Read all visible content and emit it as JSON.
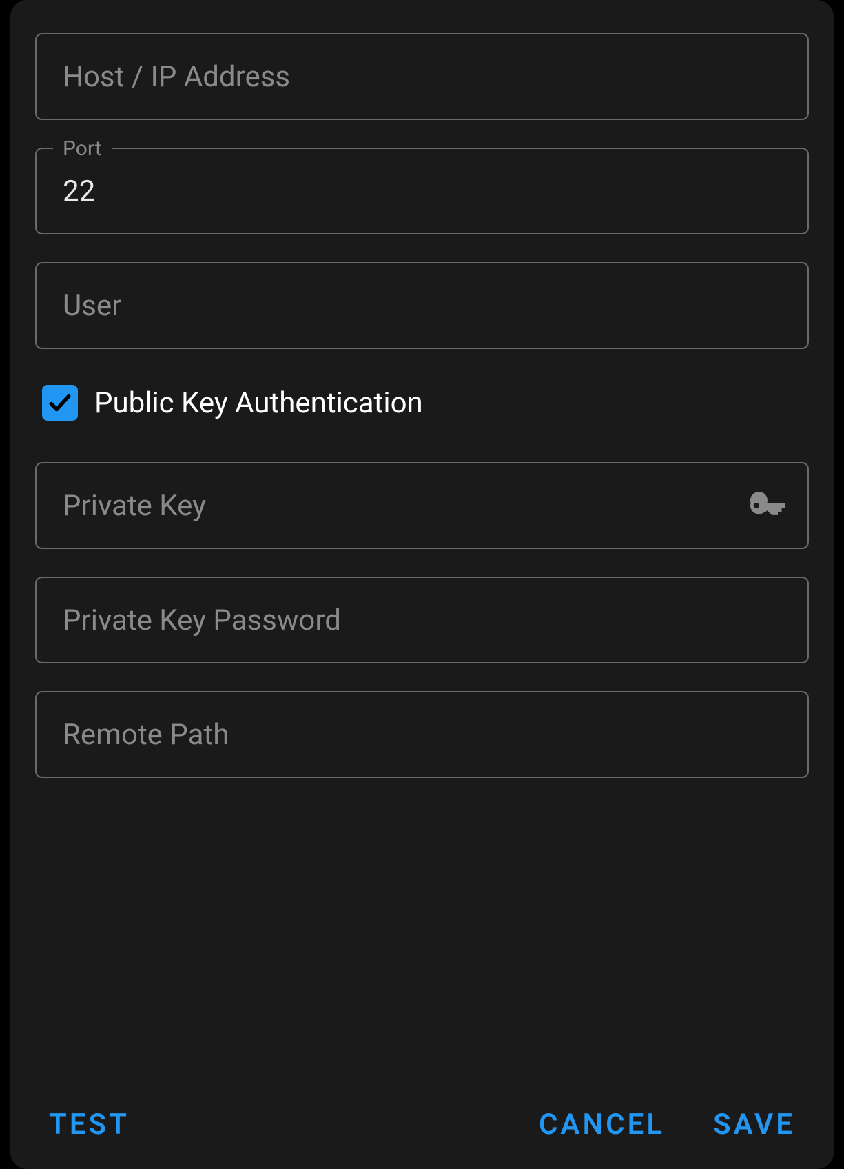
{
  "fields": {
    "host": {
      "placeholder": "Host / IP Address",
      "value": ""
    },
    "port": {
      "label": "Port",
      "value": "22"
    },
    "user": {
      "placeholder": "User",
      "value": ""
    },
    "privateKey": {
      "placeholder": "Private Key",
      "value": ""
    },
    "privateKeyPassword": {
      "placeholder": "Private Key Password",
      "value": ""
    },
    "remotePath": {
      "placeholder": "Remote Path",
      "value": ""
    }
  },
  "checkbox": {
    "publicKeyAuth": {
      "label": "Public Key Authentication",
      "checked": true
    }
  },
  "buttons": {
    "test": "TEST",
    "cancel": "CANCEL",
    "save": "SAVE"
  },
  "colors": {
    "accent": "#2196f3",
    "background": "#1a1a1a",
    "border": "#6a6a6a",
    "placeholder": "#8a8a8a"
  }
}
